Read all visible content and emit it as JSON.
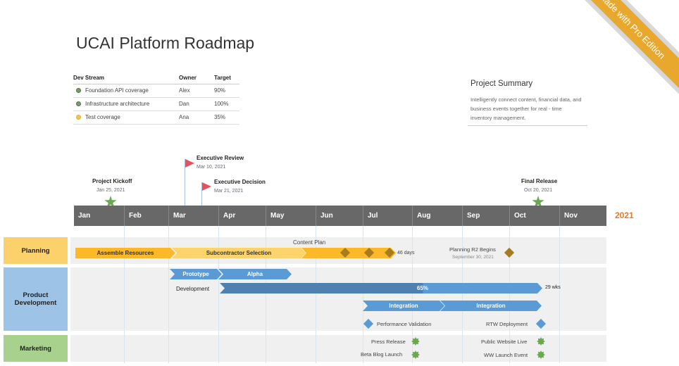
{
  "title": "UCAI Platform Roadmap",
  "ribbon": "Made with Pro Edition",
  "dev_table": {
    "headers": [
      "Dev Stream",
      "Owner",
      "Target"
    ],
    "rows": [
      {
        "stream": "Foundation API coverage",
        "owner": "Alex",
        "target": "90%",
        "color": "#6aa84f"
      },
      {
        "stream": "Infrastructure architecture",
        "owner": "Dan",
        "target": "100%",
        "color": "#6aa84f"
      },
      {
        "stream": "Test coverage",
        "owner": "Ana",
        "target": "35%",
        "color": "#f6c344"
      }
    ]
  },
  "summary": {
    "title": "Project Summary",
    "body": "Intelligently connect content, financial data, and business events together for real - time inventory management."
  },
  "year": "2021",
  "months": [
    "Jan",
    "Feb",
    "Mar",
    "Apr",
    "May",
    "Jun",
    "Jul",
    "Aug",
    "Sep",
    "Oct",
    "Nov"
  ],
  "milestones": [
    {
      "title": "Project Kickoff",
      "date": "Jan 25, 2021"
    },
    {
      "title": "Executive Review",
      "date": "Mar 10, 2021"
    },
    {
      "title": "Executive Decision",
      "date": "Mar 21, 2021"
    },
    {
      "title": "Final Release",
      "date": "Oct 20, 2021"
    }
  ],
  "lanes": {
    "planning": "Planning",
    "product": "Product Development",
    "marketing": "Marketing"
  },
  "planning": {
    "assemble": "Assemble Resources",
    "subcontractor": "Subcontractor Selection",
    "content_plan": "Content Plan",
    "duration": "46 days",
    "r2_title": "Planning R2 Begins",
    "r2_date": "September 30, 2021"
  },
  "product": {
    "prototype": "Prototype",
    "alpha": "Alpha",
    "development": "Development",
    "dev_progress": "65%",
    "dev_duration": "29 wks",
    "integration1": "Integration",
    "integration2": "Integration",
    "perf": "Performance Validation",
    "rtw": "RTW Deployment"
  },
  "marketing": {
    "press": "Press Release",
    "blog": "Beta Blog Launch",
    "website": "Public Website Live",
    "launch": "WW Launch Event"
  }
}
